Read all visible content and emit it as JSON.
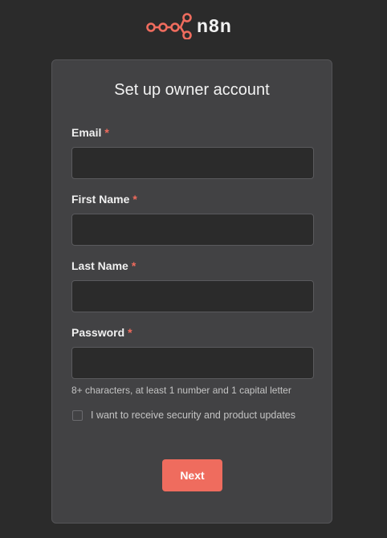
{
  "logo": {
    "text": "n8n",
    "brand_color": "#ef6c5e",
    "icon": "n8n-logo-icon"
  },
  "form": {
    "title": "Set up owner account",
    "required_marker": "*",
    "fields": [
      {
        "label": "Email",
        "value": "",
        "placeholder": ""
      },
      {
        "label": "First Name",
        "value": "",
        "placeholder": ""
      },
      {
        "label": "Last Name",
        "value": "",
        "placeholder": ""
      },
      {
        "label": "Password",
        "value": "",
        "placeholder": ""
      }
    ],
    "password_hint": "8+ characters, at least 1 number and 1 capital letter",
    "updates_checkbox": {
      "label": "I want to receive security and product updates",
      "checked": false
    },
    "next_label": "Next"
  },
  "colors": {
    "background": "#2b2b2b",
    "card": "#424244",
    "accent": "#ef6c5e",
    "required": "#ef6a5c"
  }
}
